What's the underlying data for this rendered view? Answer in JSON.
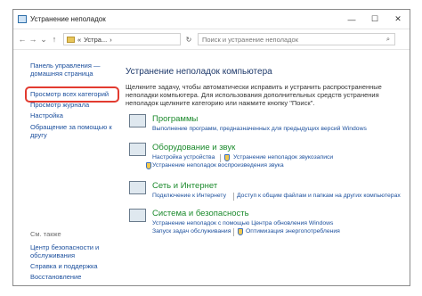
{
  "window": {
    "title": "Устранение неполадок",
    "controls": {
      "minimize": "—",
      "maximize": "☐",
      "close": "✕"
    }
  },
  "address_bar": {
    "back": "←",
    "forward": "→",
    "dropdown": "⌄",
    "up": "↑",
    "path_separator": "«",
    "path_current": "Устра...",
    "path_arrow": "›",
    "refresh": "↻",
    "search_placeholder": "Поиск и устранение неполадок",
    "search_icon": "⌕"
  },
  "sidebar": {
    "links": [
      "Панель управления —",
      "домашняя страница",
      "Просмотр всех категорий",
      "Просмотр журнала",
      "Настройка",
      "Обращение за помощью к",
      "другу"
    ],
    "see_also_label": "См. также",
    "see_also_links": [
      "Центр безопасности и",
      "обслуживания",
      "Справка и поддержка",
      "Восстановление"
    ],
    "highlight_color": "#e23b30"
  },
  "main": {
    "heading": "Устранение неполадок компьютера",
    "description": "Щелкните задачу, чтобы автоматически исправить и устранить распространенные неполадки компьютера. Для использования дополнительных средств устранения неполадок щелкните категорию или нажмите кнопку \"Поиск\".",
    "categories": [
      {
        "title": "Программы",
        "links": [
          "Выполнение программ, предназначенных для предыдущих версий Windows"
        ]
      },
      {
        "title": "Оборудование и звук",
        "links": [
          "Настройка устройства",
          "Устранение неполадок звукозаписи",
          "Устранение неполадок воспроизведения звука"
        ]
      },
      {
        "title": "Сеть и Интернет",
        "links": [
          "Подключение к Интернету",
          "Доступ к общим файлам и папкам на других компьютерах"
        ]
      },
      {
        "title": "Система и безопасность",
        "links": [
          "Устранение неполадок с помощью Центра обновления Windows",
          "Запуск задач обслуживания",
          "Оптимизация энергопотребления"
        ]
      }
    ]
  },
  "colors": {
    "link": "#1a4e9c",
    "category_title": "#1b8a2c",
    "heading": "#1f3a6b"
  }
}
